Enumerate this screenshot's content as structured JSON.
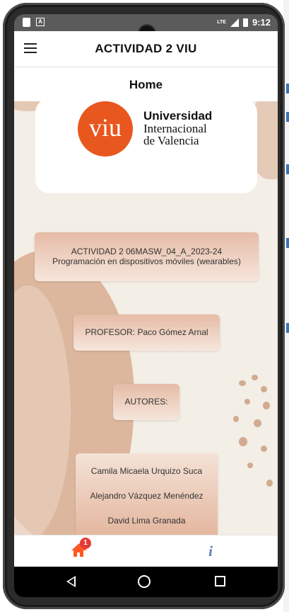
{
  "status_bar": {
    "time": "9:12",
    "network": "LTE"
  },
  "app_bar": {
    "title": "ACTIVIDAD 2 VIU"
  },
  "page": {
    "title": "Home"
  },
  "logo": {
    "mark": "viu",
    "line1": "Universidad",
    "line2": "Internacional",
    "line3": "de Valencia",
    "brand_color": "#e8571e"
  },
  "activity": {
    "line1": "ACTIVIDAD 2 06MASW_04_A_2023-24",
    "line2": "Programación en dispositivos móviles (wearables)"
  },
  "profesor": {
    "label": "PROFESOR: Paco Gómez Arnal"
  },
  "autores": {
    "label": "AUTORES:"
  },
  "authors": [
    "Camila Micaela Urquizo Suca",
    "Alejandro Vázquez Menéndez",
    "David Lima Granada"
  ],
  "bottom_nav": {
    "home_badge": "1",
    "info_glyph": "i"
  },
  "colors": {
    "background": "#f3eee6",
    "pill": "#e6bba5",
    "accent": "#ff5722",
    "info": "#5c7fb5"
  },
  "icons": [
    "menu-icon",
    "home-icon",
    "info-icon",
    "back-icon",
    "home-circle-icon",
    "recents-icon"
  ]
}
